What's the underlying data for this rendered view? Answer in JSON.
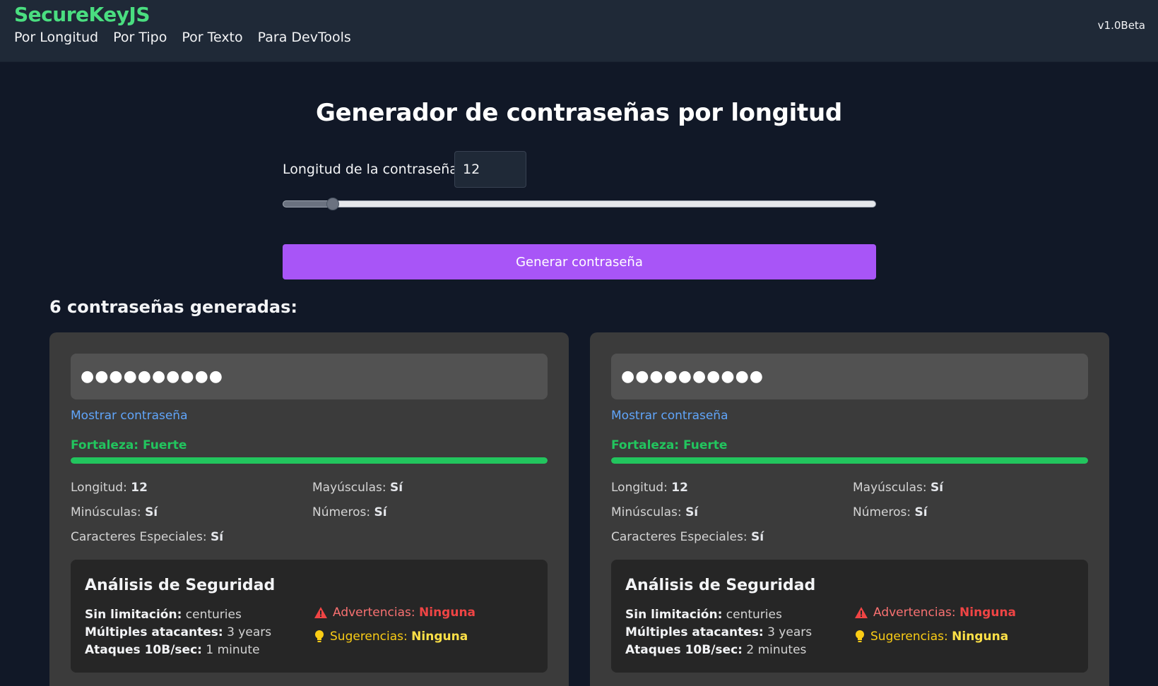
{
  "header": {
    "brand": "SecureKeyJS",
    "nav": [
      "Por Longitud",
      "Por Tipo",
      "Por Texto",
      "Para DevTools"
    ],
    "version": "v1.0Beta"
  },
  "main": {
    "title": "Generador de contraseñas por longitud",
    "length_label": "Longitud de la contraseña:",
    "length_value": "12",
    "slider": {
      "value": 12,
      "min": 4,
      "max": 100
    },
    "generate_label": "Generar contraseña",
    "count_title": "6 contraseñas generadas:"
  },
  "cards": [
    {
      "password_masked": "●●●●●●●●●●",
      "show_label": "Mostrar contraseña",
      "strength": "Fortaleza: Fuerte",
      "strength_level": 1.0,
      "props": {
        "length_label": "Longitud:",
        "length_value": "12",
        "upper_label": "Mayúsculas:",
        "upper_value": "Sí",
        "lower_label": "Minúsculas:",
        "lower_value": "Sí",
        "numbers_label": "Números:",
        "numbers_value": "Sí",
        "special_label": "Caracteres Especiales:",
        "special_value": "Sí"
      },
      "analysis": {
        "title": "Análisis de Seguridad",
        "unlimited_label": "Sin limitación:",
        "unlimited_value": "centuries",
        "multi_label": "Múltiples atacantes:",
        "multi_value": "3 years",
        "attacks_label": "Ataques 10B/sec:",
        "attacks_value": "1 minute",
        "warnings_label": "Advertencias:",
        "warnings_value": "Ninguna",
        "suggestions_label": "Sugerencias:",
        "suggestions_value": "Ninguna"
      }
    },
    {
      "password_masked": "●●●●●●●●●●",
      "show_label": "Mostrar contraseña",
      "strength": "Fortaleza: Fuerte",
      "strength_level": 1.0,
      "props": {
        "length_label": "Longitud:",
        "length_value": "12",
        "upper_label": "Mayúsculas:",
        "upper_value": "Sí",
        "lower_label": "Minúsculas:",
        "lower_value": "Sí",
        "numbers_label": "Números:",
        "numbers_value": "Sí",
        "special_label": "Caracteres Especiales:",
        "special_value": "Sí"
      },
      "analysis": {
        "title": "Análisis de Seguridad",
        "unlimited_label": "Sin limitación:",
        "unlimited_value": "centuries",
        "multi_label": "Múltiples atacantes:",
        "multi_value": "3 years",
        "attacks_label": "Ataques 10B/sec:",
        "attacks_value": "2 minutes",
        "warnings_label": "Advertencias:",
        "warnings_value": "Ninguna",
        "suggestions_label": "Sugerencias:",
        "suggestions_value": "Ninguna"
      }
    }
  ],
  "colors": {
    "brand": "#4ade80",
    "accent_button": "#a855f7",
    "strength": "#22c55e",
    "link": "#60a5fa",
    "warning": "#f87171",
    "suggestion": "#facc15"
  }
}
